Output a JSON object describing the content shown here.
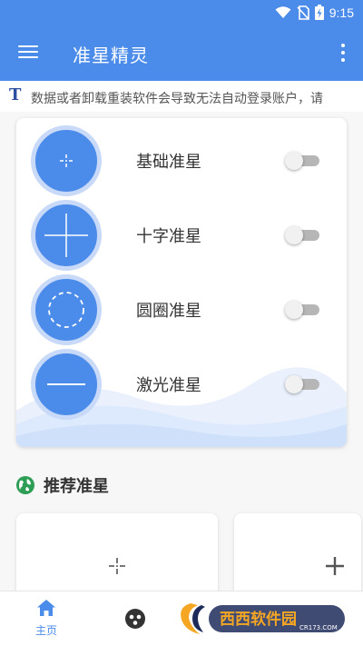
{
  "status_bar": {
    "time": "9:15"
  },
  "app_bar": {
    "title": "准星精灵"
  },
  "notice": {
    "icon_letter": "T",
    "text": "数据或者卸载重装软件会导致无法自动登录账户，请"
  },
  "crosshairs": [
    {
      "label": "基础准星",
      "icon": "dot-crosshair-icon",
      "enabled": false
    },
    {
      "label": "十字准星",
      "icon": "cross-crosshair-icon",
      "enabled": false
    },
    {
      "label": "圆圈准星",
      "icon": "circle-crosshair-icon",
      "enabled": false
    },
    {
      "label": "激光准星",
      "icon": "laser-crosshair-icon",
      "enabled": false
    }
  ],
  "recommended": {
    "title": "推荐准星",
    "items": [
      "dot-crosshair-icon",
      "plus-crosshair-icon"
    ]
  },
  "bottom_nav": {
    "home_label": "主页"
  },
  "watermark": {
    "text": "西西软件园",
    "sub": "CR173.COM"
  },
  "colors": {
    "primary": "#4b8bea",
    "ring": "#c9daf8",
    "toggle_off": "#b6b6b6",
    "globe": "#2e9e56"
  }
}
